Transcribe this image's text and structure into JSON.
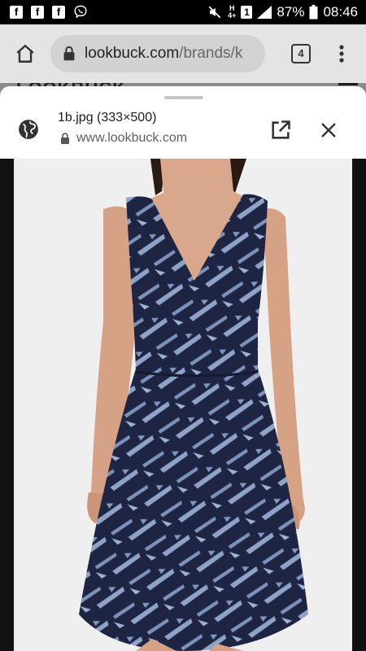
{
  "status_bar": {
    "notification_icons": [
      "facebook-icon",
      "facebook-icon",
      "facebook-icon",
      "viber-icon"
    ],
    "fb_glyph": "f",
    "network_h": "H",
    "network_sub": "4+",
    "sim_label": "1",
    "battery": "87%",
    "time": "08:46"
  },
  "browser": {
    "url_domain": "lookbuck.com",
    "url_path": "/brands/k",
    "tab_count": "4"
  },
  "page": {
    "logo": "LOOKBUCK"
  },
  "sheet": {
    "title": "1b.jpg (333×500)",
    "site": "www.lookbuck.com"
  },
  "image": {
    "subject": "navy-blue-sleeveless-v-neck-dress",
    "background_color": "#efefef",
    "dress_color": "#1d2543",
    "print_color": "#8ea3c6"
  }
}
